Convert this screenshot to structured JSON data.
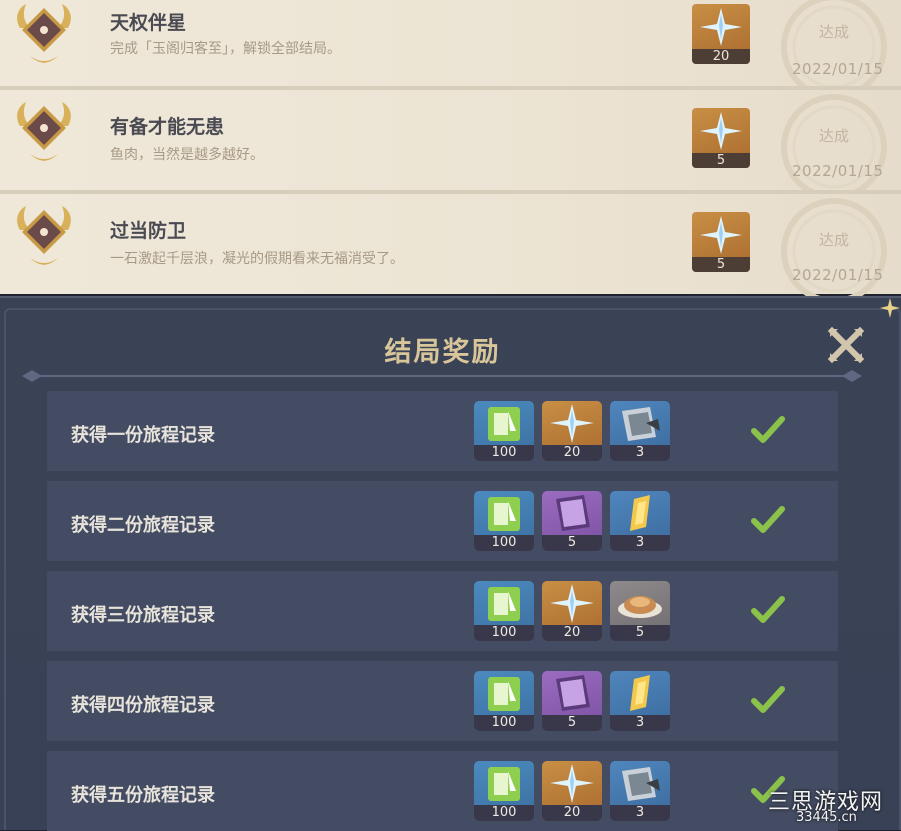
{
  "achievements": [
    {
      "title": "天权伴星",
      "desc": "完成「玉阁归客至」，解锁全部结局。",
      "reward_qty": "20",
      "status": "达成",
      "date": "2022/01/15"
    },
    {
      "title": "有备才能无患",
      "desc": "鱼肉，当然是越多越好。",
      "reward_qty": "5",
      "status": "达成",
      "date": "2022/01/15"
    },
    {
      "title": "过当防卫",
      "desc": "一石激起千层浪，凝光的假期看来无福消受了。",
      "reward_qty": "5",
      "status": "达成",
      "date": "2022/01/15"
    }
  ],
  "dialog": {
    "title": "结局奖励",
    "close_icon": "close-x-icon",
    "tasks": [
      {
        "label": "获得一份旅程记录",
        "items": [
          {
            "icon": "adventure-exp-icon",
            "qty": "100"
          },
          {
            "icon": "primogem-icon",
            "qty": "20"
          },
          {
            "icon": "hero-wit-icon",
            "qty": "3"
          }
        ],
        "done": true
      },
      {
        "label": "获得二份旅程记录",
        "items": [
          {
            "icon": "adventure-exp-icon",
            "qty": "100"
          },
          {
            "icon": "talent-book-icon",
            "qty": "5"
          },
          {
            "icon": "mystic-ore-icon",
            "qty": "3"
          }
        ],
        "done": true
      },
      {
        "label": "获得三份旅程记录",
        "items": [
          {
            "icon": "adventure-exp-icon",
            "qty": "100"
          },
          {
            "icon": "primogem-icon",
            "qty": "20"
          },
          {
            "icon": "food-dish-icon",
            "qty": "5"
          }
        ],
        "done": true
      },
      {
        "label": "获得四份旅程记录",
        "items": [
          {
            "icon": "adventure-exp-icon",
            "qty": "100"
          },
          {
            "icon": "talent-book-icon",
            "qty": "5"
          },
          {
            "icon": "mystic-ore-icon",
            "qty": "3"
          }
        ],
        "done": true
      },
      {
        "label": "获得五份旅程记录",
        "items": [
          {
            "icon": "adventure-exp-icon",
            "qty": "100"
          },
          {
            "icon": "primogem-icon",
            "qty": "20"
          },
          {
            "icon": "hero-wit-icon",
            "qty": "3"
          }
        ],
        "done": true
      }
    ]
  },
  "watermark": {
    "name": "三思游戏网",
    "url": "33445.cn"
  },
  "colors": {
    "gold_title": "#d8c69a",
    "check_green": "#8bc34a",
    "row_bg": "#434c62"
  }
}
